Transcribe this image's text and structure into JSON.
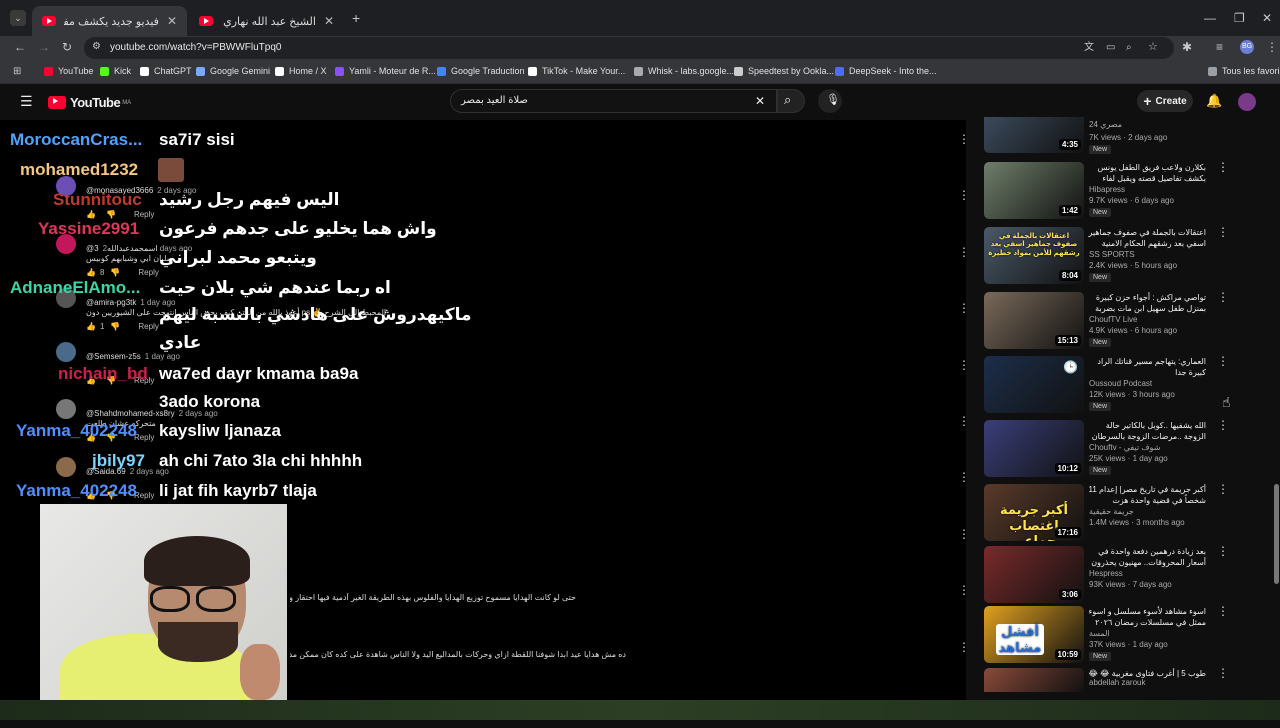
{
  "browser": {
    "tabs": [
      {
        "title": "فيديو جديد يكشف مفاجأة حول واقـ"
      },
      {
        "title": "الشيخ عبد الله نهاري يعلق على كارثة"
      }
    ],
    "url": "youtube.com/watch?v=PBWWFluTpq0",
    "profile_initials": "BG",
    "bookmarks": [
      {
        "label": "YouTube",
        "color": "#ff0033"
      },
      {
        "label": "Kick",
        "color": "#53fc18"
      },
      {
        "label": "ChatGPT",
        "color": "#ffffff"
      },
      {
        "label": "Google Gemini",
        "color": "#7aa8ff"
      },
      {
        "label": "Home / X",
        "color": "#ffffff"
      },
      {
        "label": "Yamli - Moteur de R...",
        "color": "#8a4fff"
      },
      {
        "label": "Google Traduction",
        "color": "#4285f4"
      },
      {
        "label": "TikTok - Make Your...",
        "color": "#ffffff"
      },
      {
        "label": "Whisk - labs.google...",
        "color": "#aaaaaa"
      },
      {
        "label": "Speedtest by Ookla...",
        "color": "#cccccc"
      },
      {
        "label": "DeepSeek - Into the...",
        "color": "#4d6bfe"
      }
    ],
    "all_bookmarks": "Tous les favoris"
  },
  "youtube": {
    "logo": "YouTube",
    "region": "MA",
    "search_value": "صلاة العيد بمصر",
    "create_label": "Create"
  },
  "overlay_chat": [
    {
      "user": "MoroccanCras...",
      "color": "#4fa3ff",
      "msg": "sa7i7 sisi"
    },
    {
      "user": "mohamed1232",
      "color": "#f5c77e",
      "msg": ""
    },
    {
      "user": "Stunnitouc",
      "color": "#c0392b",
      "msg": "اليس فيهم رجل رشيد"
    },
    {
      "user": "Yassine2991",
      "color": "#e0365a",
      "msg": "واش هما يخليو على جدهم فرعون"
    },
    {
      "user": "",
      "color": "#fff",
      "msg": "ويتبعو محمد لبراني"
    },
    {
      "user": "AdnaneElAmo...",
      "color": "#3ad6a8",
      "msg": "اه ربما عندهم شي بلان حيت"
    },
    {
      "user": "",
      "color": "#fff",
      "msg": "ماكيهدروش على هادشي بالنسبة ليهم"
    },
    {
      "user": "",
      "color": "#fff",
      "msg": "عادي"
    },
    {
      "user": "nichain_bd",
      "color": "#d01f4f",
      "msg": "wa7ed dayr kmama ba9a"
    },
    {
      "user": "",
      "color": "#fff",
      "msg": "3ado korona"
    },
    {
      "user": "Yanma_402248",
      "color": "#4f8fff",
      "msg": "kaysliw ljanaza"
    },
    {
      "user": "jbily97",
      "color": "#7ad6ff",
      "msg": "ah chi 7ato 3la chi hhhhh"
    },
    {
      "user": "Yanma_402248",
      "color": "#4f8fff",
      "msg": "li jat fih kayrb7 tlaja"
    }
  ],
  "comments": [
    {
      "handle": "@monasayed3666",
      "time": "2 days ago",
      "text": "",
      "likes": ""
    },
    {
      "handle": "@اسمحمدعبدالله3",
      "time": "2 days ago",
      "text": "سلبان ابي وشبابهم كوبيس",
      "likes": "8"
    },
    {
      "handle": "@amira-pg3tk",
      "time": "1 day ago",
      "text": "أعوذ بالله من الفتن كيف يحض الناس انتهجت على الشيوريين دون ps ✌️ المحبط إلى الشرح",
      "likes": "1"
    },
    {
      "handle": "@Semsem-z5s",
      "time": "1 day ago",
      "text": "",
      "likes": ""
    },
    {
      "handle": "@Shahdmohamed-xs8ry",
      "time": "2 days ago",
      "text": "متحركه عشان طلعت",
      "likes": ""
    },
    {
      "handle": "@Saida.69",
      "time": "2 days ago",
      "text": "",
      "likes": ""
    }
  ],
  "comment_actions": {
    "reply": "Reply"
  },
  "bottom_comments": [
    "حتى لو كانت الهدايا مسموح توزيع الهدايا والفلوس بهذه الطريقة الغير آدمية فيها احتقار وتعالى على الناس ده عيب لا",
    "ده مش هدايا عيد ابدا شوفنا اللقطة ازاي وحركات بالمداليع اليد ولا الناس شاهدة على كده كان ممكن مد بيتزل بطول للناس ازاي مع عيب"
  ],
  "recommendations": [
    {
      "title": "",
      "channel": "24 مصري",
      "views": "7K views · 2 days ago",
      "duration": "4:35",
      "new": true,
      "thumb": "#3b4a5c"
    },
    {
      "title": "بكلارن ولاعب فريق الطفل يونس بكشف تفاصيل قصته ويقبل لفاء حكيم زياش لهذا",
      "channel": "Hibapress",
      "views": "9.7K views · 6 days ago",
      "duration": "1:42",
      "new": true,
      "thumb": "#6f7e6a"
    },
    {
      "title": "اعتقالات بالجملة في صفوف جماهير اسفي بعد رشقهم الحكام الامنية بمواد خطيرة",
      "channel": "SS SPORTS",
      "views": "2.4K views · 5 hours ago",
      "duration": "8:04",
      "new": true,
      "thumb": "#4a5a6a"
    },
    {
      "title": "تواصي مراكش : أجواء حزن كبيرة بمنزل طفل سهيل ابن مات بضربة حجر من طرف",
      "channel": "ChoufTV Live",
      "views": "4.9K views · 6 hours ago",
      "duration": "15:13",
      "new": true,
      "thumb": "#7a6a5a"
    },
    {
      "title": "العماري: يتهاجم مسير قناتك الراد كبيرة جدا",
      "channel": "Oussoud Podcast",
      "views": "12K views · 3 hours ago",
      "duration": "",
      "new": true,
      "thumb": "#1c2e4a"
    },
    {
      "title": "الله يشفيها ..كوبل بالكاتير حالة الزوجة ..مرضات الزوجة بالسرطان والزوج هجمها",
      "channel": "Chouftv - شوف تيفي",
      "views": "25K views · 1 day ago",
      "duration": "10:12",
      "new": true,
      "thumb": "#3a3f7a"
    },
    {
      "title": "أكبر جريمة في تاريخ مصر| إعدام 11 شخصاً في قضية واحدة هزت المجتمع",
      "channel": "جريمة حقيقية",
      "views": "1.4M views · 3 months ago",
      "duration": "17:16",
      "new": false,
      "thumb": "#5a3a2a"
    },
    {
      "title": "بعد زيادة درهمين دفعة واحدة في أسعار المحروقات.. مهنيون يحذرون من سخطهم",
      "channel": "Hespress",
      "views": "93K views · 7 days ago",
      "duration": "3:06",
      "new": false,
      "thumb": "#7a2a2a"
    },
    {
      "title": "اسوء مشاهد لأسوء مسلسل و اسوء ممثل في مسلسلات رمضان ٢٠٢٦ ممكن تشوفها في",
      "channel": "المسة",
      "views": "37K views · 1 day ago",
      "duration": "10:59",
      "new": true,
      "thumb": "#e0a020"
    },
    {
      "title": "طوب 5 | أغرب فتاوى مغربية 😂 😂",
      "channel": "abdellah zarouk",
      "views": "",
      "duration": "",
      "new": false,
      "thumb": "#8a4a3a"
    }
  ],
  "thumb_texts": {
    "r3": "اعتقالات بالجملة في صفوف جماهير اسفي بعد رشقهم للأمن بمواد خطيرة",
    "r7": "أكبر جريمة اغتصاب جماعي",
    "r9": "أفشل مشاهد"
  },
  "colors": {
    "bg": "#0f0f0f",
    "accent": "#ff0033"
  }
}
